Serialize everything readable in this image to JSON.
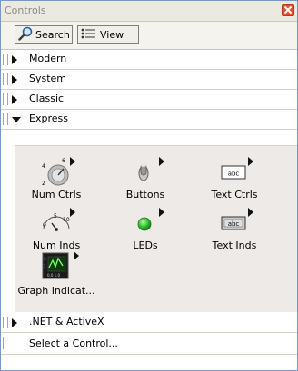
{
  "window": {
    "title": "Controls"
  },
  "toolbar": {
    "search_label": "Search",
    "view_label": "View"
  },
  "sections": {
    "modern": "Modern",
    "system": "System",
    "classic": "Classic",
    "express": "Express",
    "dotnet": ".NET & ActiveX",
    "select": "Select a Control..."
  },
  "palette": {
    "items": [
      {
        "label": "Num Ctrls",
        "icon": "knob-dial-icon"
      },
      {
        "label": "Buttons",
        "icon": "toggle-switch-icon"
      },
      {
        "label": "Text Ctrls",
        "icon": "text-box-icon",
        "glyph": "abc"
      },
      {
        "label": "Num Inds",
        "icon": "gauge-icon",
        "ticks": [
          "0",
          "5",
          "10"
        ]
      },
      {
        "label": "LEDs",
        "icon": "green-led-icon"
      },
      {
        "label": "Text Inds",
        "icon": "text-indicator-icon",
        "glyph": "abc"
      },
      {
        "label": "Graph Indicat...",
        "icon": "graph-icon"
      }
    ]
  },
  "colors": {
    "led": "#29c12c",
    "palette_bg": "#edeae8",
    "title_bar": "#eceae0"
  }
}
